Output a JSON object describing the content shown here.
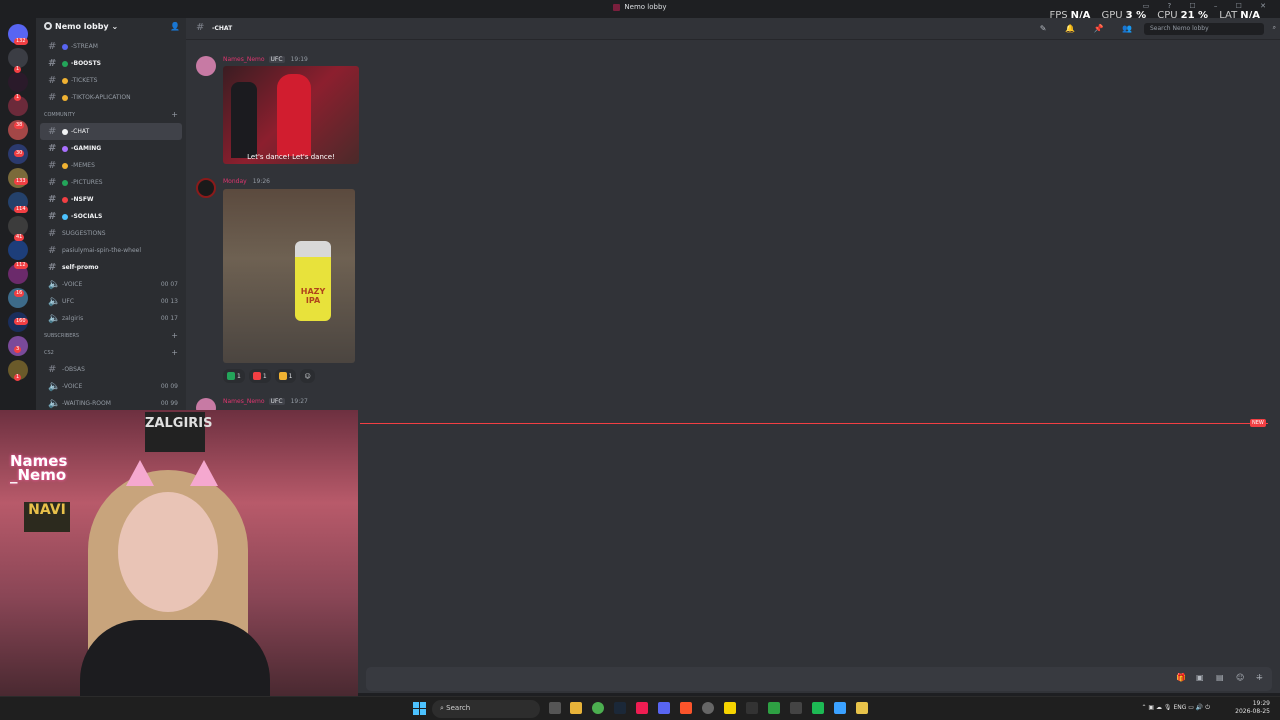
{
  "window": {
    "title": "Nemo lobby"
  },
  "overlay": {
    "fps_label": "FPS",
    "fps_value": "N/A",
    "gpu_label": "GPU",
    "gpu_value": "3 %",
    "cpu_label": "CPU",
    "cpu_value": "21 %",
    "lat_label": "LAT",
    "lat_value": "N/A"
  },
  "rail": {
    "badges": [
      "132",
      "1",
      "1",
      "38",
      "30",
      "133",
      "114",
      "41",
      "112",
      "16",
      "160",
      "3",
      "1"
    ]
  },
  "server": {
    "name": "Nemo lobby"
  },
  "channels": [
    {
      "label": "-STREAM",
      "kind": "text",
      "dot": "#5865f2"
    },
    {
      "label": "-BOOSTS",
      "kind": "text",
      "dot": "#23a55a",
      "bright": true
    },
    {
      "label": "-TICKETS",
      "kind": "text",
      "dot": "#f0b232"
    },
    {
      "label": "-TIKTOK-APLICATION",
      "kind": "text",
      "dot": "#f0b232"
    }
  ],
  "categories": {
    "community": "COMMUNITY",
    "subscribers": "SUBSCRIBERS",
    "cs2": "CS2"
  },
  "community_channels": [
    {
      "label": "-CHAT",
      "dot": "#f2f3f5",
      "active": true
    },
    {
      "label": "-GAMING",
      "dot": "#a970ff",
      "bright": true
    },
    {
      "label": "-MEMES",
      "dot": "#f0b232"
    },
    {
      "label": "-PICTURES",
      "dot": "#23a55a"
    },
    {
      "label": "-NSFW",
      "dot": "#f23f43",
      "bright": true
    },
    {
      "label": "-SOCIALS",
      "dot": "#4cc2ff",
      "bright": true
    },
    {
      "label": "SUGGESTIONS",
      "dot": ""
    },
    {
      "label": "pasiulymai-spin-the-wheel",
      "dot": ""
    },
    {
      "label": "self-promo",
      "dot": "",
      "bright": true
    }
  ],
  "voice_channels": [
    {
      "label": "-VOICE",
      "tail": "00 07"
    },
    {
      "label": "UFC",
      "tail": "00 13"
    },
    {
      "label": "zalgiris",
      "tail": "00 17"
    }
  ],
  "sub_channels": [
    {
      "label": "-OBSAS",
      "kind": "text",
      "tail": ""
    },
    {
      "label": "-VOICE",
      "kind": "voice",
      "tail": "00 09"
    },
    {
      "label": "-WAITING-ROOM",
      "kind": "voice",
      "tail": "00 99"
    }
  ],
  "chat": {
    "channel_name": "-CHAT",
    "search_placeholder": "Search Nemo lobby",
    "messages": [
      {
        "user": "Names_Nemo",
        "tag": "UFC",
        "time": "19:19",
        "gif_caption": "Let's dance! Let's dance!"
      },
      {
        "user": "Monday",
        "time": "19:26",
        "can_label": "HAZY IPA"
      },
      {
        "user": "Names_Nemo",
        "tag": "UFC",
        "time": "19:27"
      }
    ],
    "reactions": [
      {
        "count": "1",
        "color": "#23a55a"
      },
      {
        "count": "1",
        "color": "#f23f43"
      },
      {
        "count": "1",
        "color": "#f0b232"
      }
    ],
    "new_badge": "NEW"
  },
  "webcam": {
    "sign": "Names\n_Nemo",
    "banner": "ZALGIRIS",
    "poster": "NAVI"
  },
  "taskbar": {
    "search": "Search",
    "tray_lang": "ENG",
    "time": "19:29",
    "date": "2026-08-25"
  }
}
